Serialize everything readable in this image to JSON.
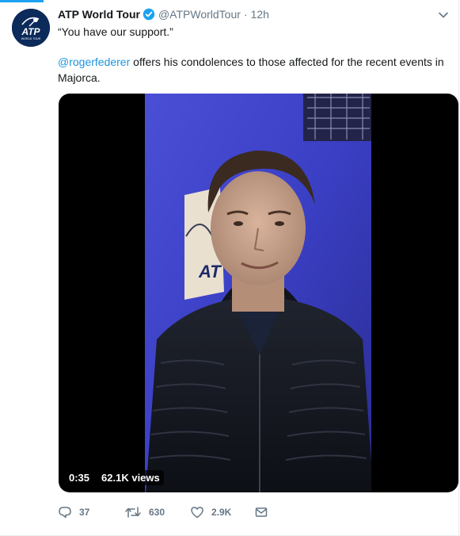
{
  "tweet": {
    "author_name": "ATP World Tour",
    "handle": "@ATPWorldTour",
    "separator": "·",
    "time": "12h",
    "text_line1": "“You have our support.”",
    "mention": "@rogerfederer",
    "text_line2_rest": " offers his condolences to those affected for the recent events in Majorca.",
    "verified_icon": "verified-badge-icon",
    "avatar_logo_text": "ATP",
    "avatar_logo_sub": "WORLD TOUR"
  },
  "video": {
    "duration": "0:35",
    "views": "62.1K views"
  },
  "actions": {
    "reply_count": "37",
    "retweet_count": "630",
    "like_count": "2.9K"
  },
  "colors": {
    "link": "#1b95e0",
    "muted": "#657786",
    "verified": "#1da1f2"
  }
}
